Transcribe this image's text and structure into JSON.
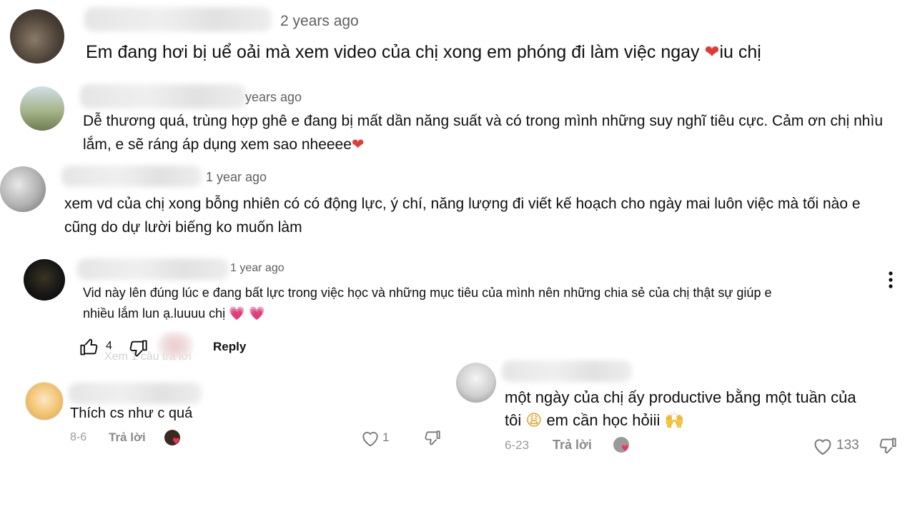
{
  "c1": {
    "time": "2 years ago",
    "text": "Em đang hơi bị uể oải mà xem video của chị xong em phóng đi làm việc ngay",
    "emoji": "❤",
    "tail": "iu chị"
  },
  "c2": {
    "time": "years ago",
    "line1": "Dễ thương quá, trùng hợp ghê e đang bị mất dần năng suất và có trong mình những suy nghĩ tiêu cực. Cảm ơn chị nhìu",
    "line2": "lắm, e sẽ ráng áp dụng xem sao nheeee",
    "emoji": "❤"
  },
  "c3": {
    "time": "1 year ago",
    "line1": "xem vd của chị xong bỗng nhiên có có động lực, ý chí, năng lượng đi viết kế hoạch cho ngày mai luôn việc mà tối nào e",
    "line2": "cũng do dự lười biếng ko muốn làm"
  },
  "c4": {
    "time": "1 year ago",
    "line1": "Vid này lên đúng lúc e đang bất lực trong việc học và những mục tiêu của mình nên những chia sẻ của chị thật sự giúp e",
    "line2": "nhiều lắm lun ạ.luuuu chị",
    "emoji": "💗 💗",
    "likes": "4",
    "reply": "Reply",
    "menu_icon": "more-vert-icon",
    "replies_ghost": "Xem 1 câu trả lời"
  },
  "c5": {
    "text": "Thích cs như c quá",
    "date": "8-6",
    "reply": "Trả lời",
    "likes": "1"
  },
  "c6": {
    "line1": "một ngày của chị ấy productive bằng một tuần của",
    "line2a": "tôi",
    "emoji1": "😩",
    "line2b": "em cần học hỏiii",
    "emoji2": "🙌",
    "date": "6-23",
    "reply": "Trả lời",
    "likes": "133"
  }
}
